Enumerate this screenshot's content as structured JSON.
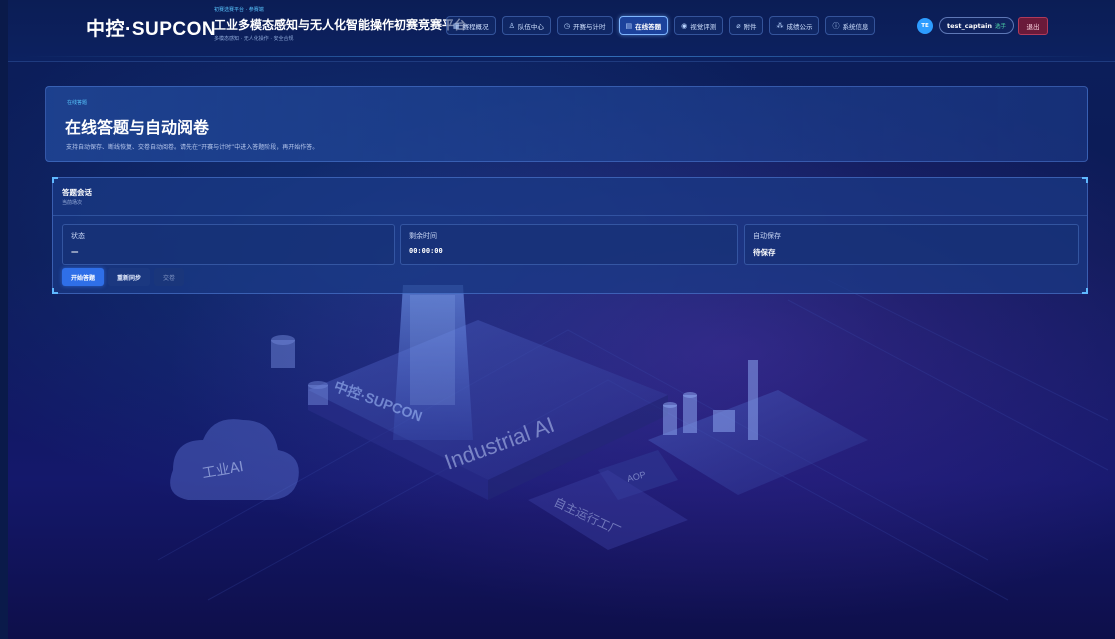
{
  "header": {
    "logo_text": "中控·SUPCON",
    "title_top": "初赛选赛平台 · 参赛端",
    "title_main": "工业多模态感知与无人化智能操作初赛竞赛平台",
    "title_sub": "多模态感知 · 无人化操作 · 安全合规",
    "nav": [
      {
        "label": "赛程概况",
        "icon": "schedule-icon",
        "glyph": "▦",
        "active": false
      },
      {
        "label": "队伍中心",
        "icon": "team-icon",
        "glyph": "♙",
        "active": false
      },
      {
        "label": "开赛与计时",
        "icon": "clock-icon",
        "glyph": "◷",
        "active": false
      },
      {
        "label": "在线答题",
        "icon": "document-icon",
        "glyph": "▤",
        "active": true
      },
      {
        "label": "视觉评测",
        "icon": "eye-icon",
        "glyph": "◉",
        "active": false
      },
      {
        "label": "附件",
        "icon": "paperclip-icon",
        "glyph": "⌀",
        "active": false
      },
      {
        "label": "成绩公示",
        "icon": "ranking-icon",
        "glyph": "⁂",
        "active": false
      },
      {
        "label": "系统信息",
        "icon": "info-icon",
        "glyph": "ⓘ",
        "active": false
      }
    ],
    "avatar_initials": "TE",
    "user_name": "test_captain",
    "user_role": "选手",
    "logout_label": "退出"
  },
  "hero": {
    "tag": "在线答题",
    "title": "在线答题与自动阅卷",
    "description": "支持自动保存、断线恢复、交卷自动阅卷。请先在“开赛与计时”中进入答题阶段，再开始作答。"
  },
  "session": {
    "title": "答题会话",
    "subtitle": "当前场次",
    "stats": [
      {
        "label": "状态",
        "value": "—"
      },
      {
        "label": "剩余时间",
        "value": "00:00:00"
      },
      {
        "label": "自动保存",
        "value": "待保存"
      }
    ],
    "buttons": {
      "start": "开始答题",
      "resync": "重新同步",
      "submit": "交卷"
    }
  },
  "illustration": {
    "brand_text": "中控·SUPCON",
    "industrial_text": "Industrial AI",
    "cloud_text": "工业AI",
    "board_text": "AOP",
    "factory_text": "自主运行工厂"
  },
  "colors": {
    "accent": "#2f6fe8",
    "logout_bg": "#6a1a3a",
    "page_bg": "#0c1a55"
  }
}
